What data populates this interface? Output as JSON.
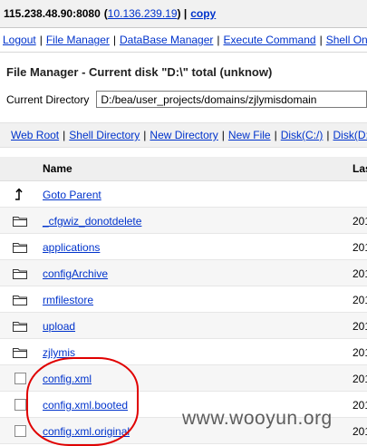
{
  "topbar": {
    "host": "115.238.48.90:8080",
    "open_paren": "(",
    "ip": "10.136.239.19",
    "close_sep": ") |",
    "copy": "copy"
  },
  "menu": {
    "items": [
      "Logout",
      "File Manager",
      "DataBase Manager",
      "Execute Command",
      "Shell OnL"
    ],
    "sep": "|"
  },
  "page": {
    "heading": "File Manager - Current disk \"D:\\\" total (unknow)",
    "cwd_label": "Current Directory",
    "cwd_value": "D:/bea/user_projects/domains/zjlymisdomain"
  },
  "actions": {
    "items": [
      "Web Root",
      "Shell Directory",
      "New Directory",
      "New File",
      "Disk(C:/)",
      "Disk(D:/"
    ],
    "sep": "|"
  },
  "table": {
    "col_name": "Name",
    "col_last": "Las",
    "rows": [
      {
        "name": "Goto Parent",
        "type": "parent-arrow-icon",
        "date": ""
      },
      {
        "name": "_cfgwiz_donotdelete",
        "type": "folder-icon",
        "date": "201"
      },
      {
        "name": "applications",
        "type": "folder-icon",
        "date": "201"
      },
      {
        "name": "configArchive",
        "type": "folder-icon",
        "date": "201"
      },
      {
        "name": "rmfilestore",
        "type": "folder-icon",
        "date": "201"
      },
      {
        "name": "upload",
        "type": "folder-icon",
        "date": "201"
      },
      {
        "name": "zjlymis",
        "type": "folder-icon",
        "date": "201"
      },
      {
        "name": "config.xml",
        "type": "checkbox",
        "date": "201"
      },
      {
        "name": "config.xml.booted",
        "type": "checkbox",
        "date": "201"
      },
      {
        "name": "config.xml.original",
        "type": "checkbox",
        "date": "201"
      }
    ]
  },
  "watermark": "www.wooyun.org"
}
